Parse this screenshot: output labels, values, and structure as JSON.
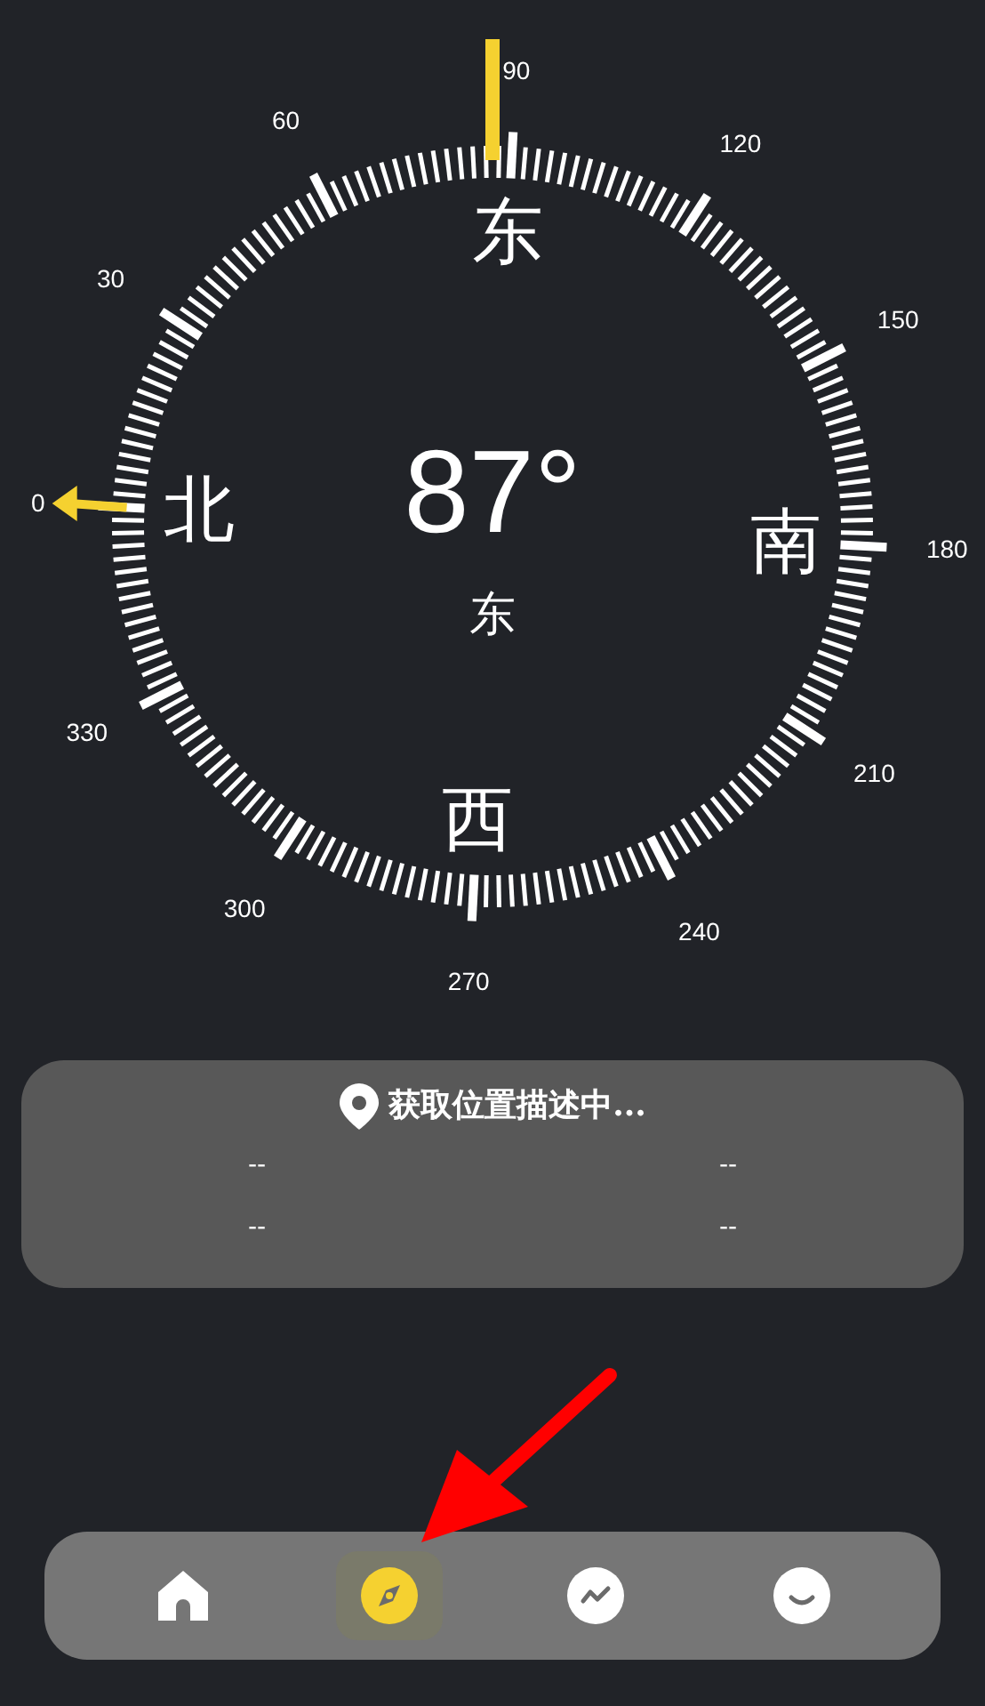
{
  "compass": {
    "reading": "87°",
    "direction": "东",
    "degree_labels": [
      "0",
      "30",
      "60",
      "90",
      "120",
      "150",
      "180",
      "210",
      "240",
      "270",
      "300",
      "330"
    ],
    "cardinals": [
      "北",
      "东",
      "南",
      "西"
    ]
  },
  "location_card": {
    "title": "获取位置描述中...",
    "values": [
      "--",
      "--",
      "--",
      "--"
    ]
  },
  "nav": [
    {
      "kind": "home",
      "selected": false
    },
    {
      "kind": "compass",
      "selected": true
    },
    {
      "kind": "trend",
      "selected": false
    },
    {
      "kind": "smile",
      "selected": false
    }
  ]
}
